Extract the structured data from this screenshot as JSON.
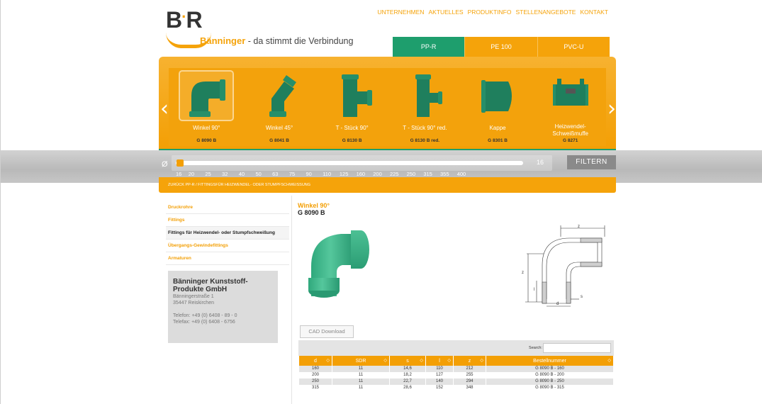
{
  "logo": {
    "brand": "Bänninger",
    "tagline": " - da stimmt die Verbindung"
  },
  "topnav": [
    "UNTERNEHMEN",
    "AKTUELLES",
    "PRODUKTINFO",
    "STELLENANGEBOTE",
    "KONTAKT"
  ],
  "material_tabs": [
    "PP-R",
    "PE 100",
    "PVC-U"
  ],
  "carousel": {
    "items": [
      {
        "name": "Winkel 90°",
        "code": "G 8090 B"
      },
      {
        "name": "Winkel 45°",
        "code": "G 8041 B"
      },
      {
        "name": "T - Stück 90°",
        "code": "G 8130 B"
      },
      {
        "name": "T - Stück 90° red.",
        "code": "G 8130 B red."
      },
      {
        "name": "Kappe",
        "code": "G 8301 B"
      },
      {
        "name": "Heizwendel-\nSchweißmuffe",
        "code": "G 8271"
      }
    ]
  },
  "slider": {
    "symbol": "Ø",
    "value": "16",
    "ticks": [
      "16",
      "20",
      "25",
      "32",
      "40",
      "50",
      "63",
      "75",
      "90",
      "110",
      "125",
      "160",
      "200",
      "225",
      "250",
      "315",
      "355",
      "400"
    ],
    "filter_label": "FILTERN"
  },
  "breadcrumb": "ZURÜCK PP-R / FITTINGSFÜR HEIZWENDEL- ODER STUMPFSCHWEISSUNG",
  "sidebar": {
    "items": [
      {
        "label": "Druckrohre"
      },
      {
        "label": "Fittings"
      },
      {
        "label": "Fittings für Heizwendel- oder Stumpfschweißung"
      },
      {
        "label": "Übergangs-Gewindefittings"
      },
      {
        "label": "Armaturen"
      }
    ],
    "contact": {
      "name": "Bänninger Kunststoff-Produkte GmbH",
      "street": "Bänningerstraße 1",
      "city": "35447 Reiskirchen",
      "phone": "Telefon: +49 (0) 6408 - 89 - 0",
      "fax": "Telefax: +49 (0) 6408 - 6756"
    }
  },
  "product": {
    "title": "Winkel 90°",
    "code": "G 8090 B"
  },
  "drawing_labels": {
    "z": "z",
    "l": "l",
    "s": "s",
    "d": "d"
  },
  "cad_label": "CAD Download",
  "table": {
    "search_label": "Search:",
    "headers": [
      "d",
      "SDR",
      "s",
      "l",
      "z",
      "Bestellnummer"
    ],
    "rows": [
      [
        "160",
        "11",
        "14,6",
        "110",
        "212",
        "G 8090 B - 160"
      ],
      [
        "200",
        "11",
        "18,2",
        "127",
        "255",
        "G 8090 B - 200"
      ],
      [
        "250",
        "11",
        "22,7",
        "140",
        "294",
        "G 8090 B - 250"
      ],
      [
        "315",
        "11",
        "28,6",
        "152",
        "348",
        "G 8090 B - 315"
      ]
    ]
  },
  "colors": {
    "accent": "#f39f05",
    "green": "#1e9e6d",
    "gray_band": "#c4c4c4"
  },
  "icons": [
    "chevron-left-icon",
    "chevron-right-icon",
    "sort-icon"
  ]
}
